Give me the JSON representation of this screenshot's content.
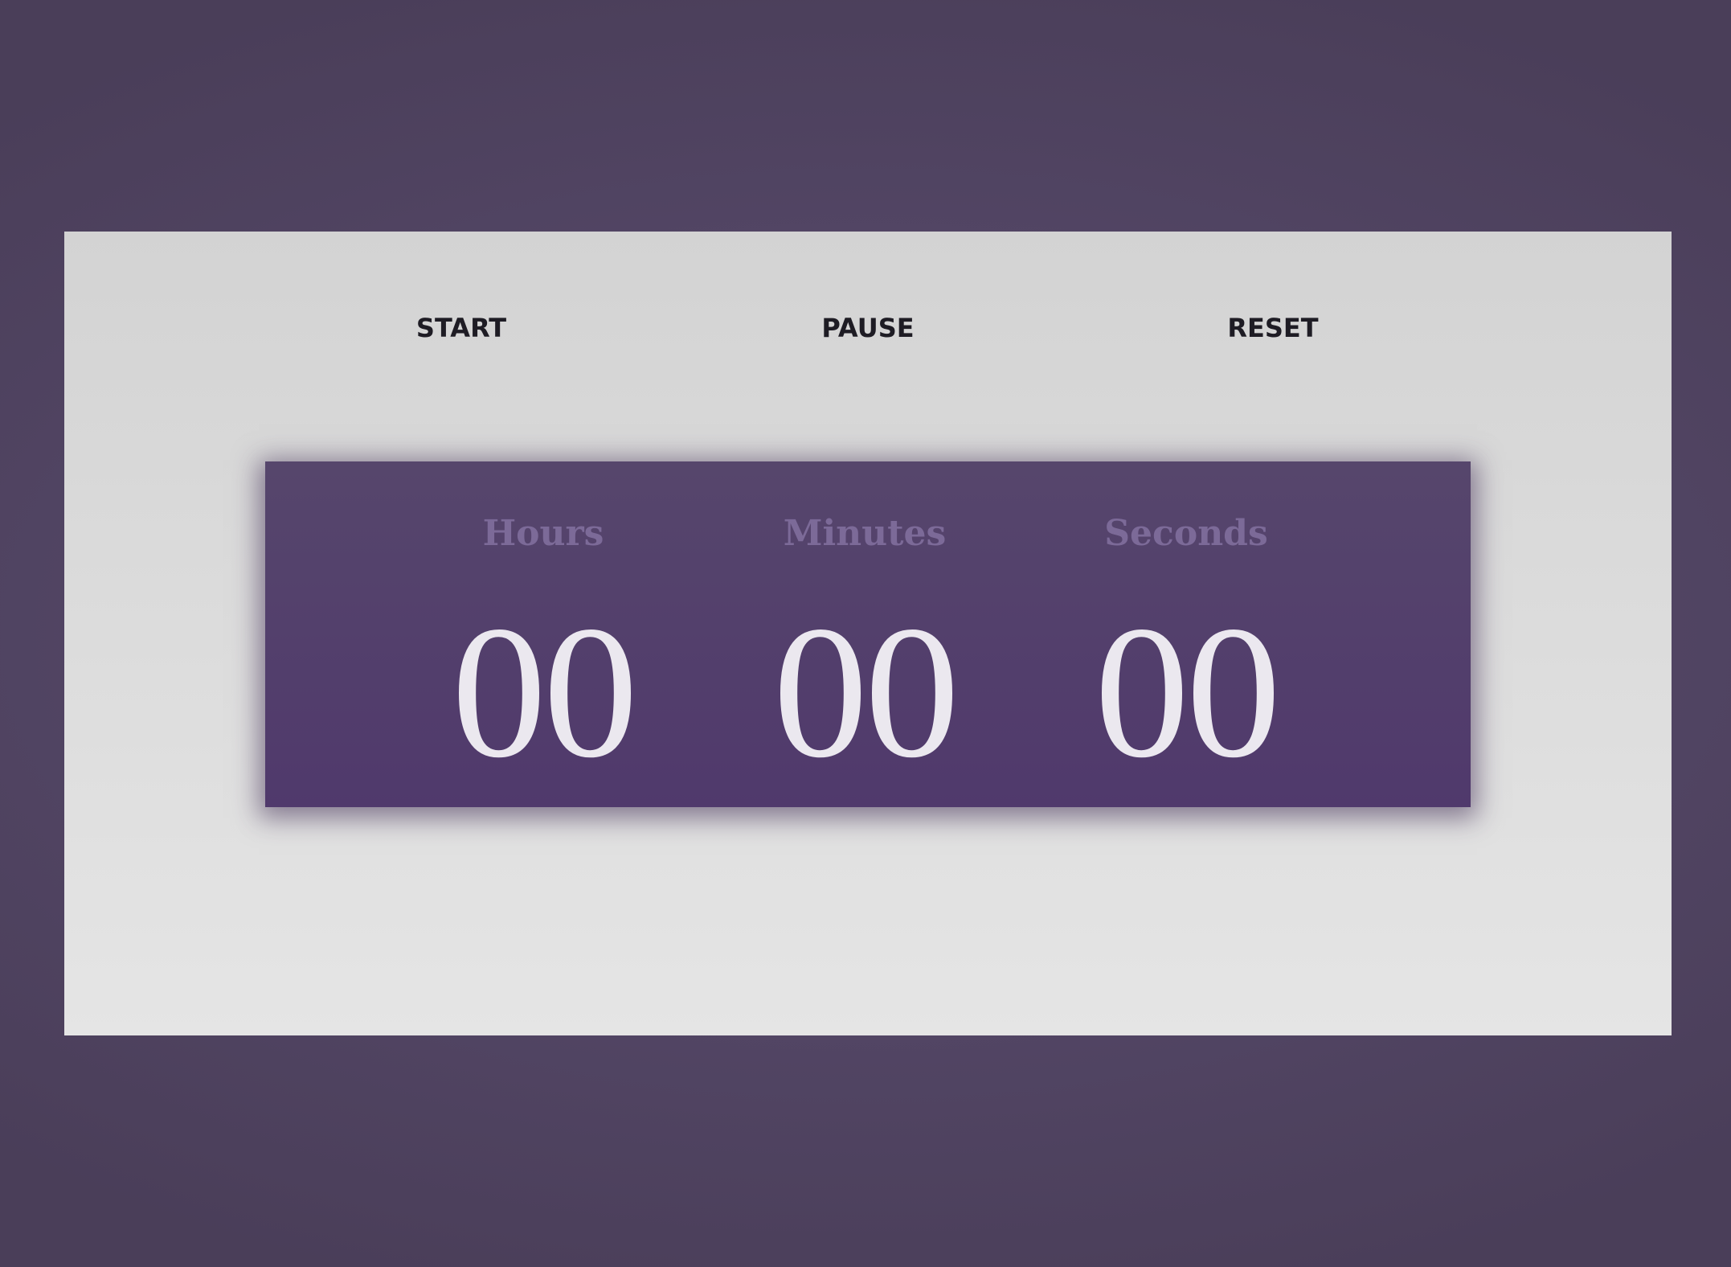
{
  "controls": {
    "start_label": "START",
    "pause_label": "PAUSE",
    "reset_label": "RESET"
  },
  "timer": {
    "hours": {
      "label": "Hours",
      "value": "00"
    },
    "minutes": {
      "label": "Minutes",
      "value": "00"
    },
    "seconds": {
      "label": "Seconds",
      "value": "00"
    }
  },
  "colors": {
    "background": "#4a3e59",
    "card": "#dcdcdc",
    "panel": "#52406c",
    "label_text": "#7c6a98",
    "digit_text": "#ebe8ef",
    "button_text": "#1e1c24"
  }
}
